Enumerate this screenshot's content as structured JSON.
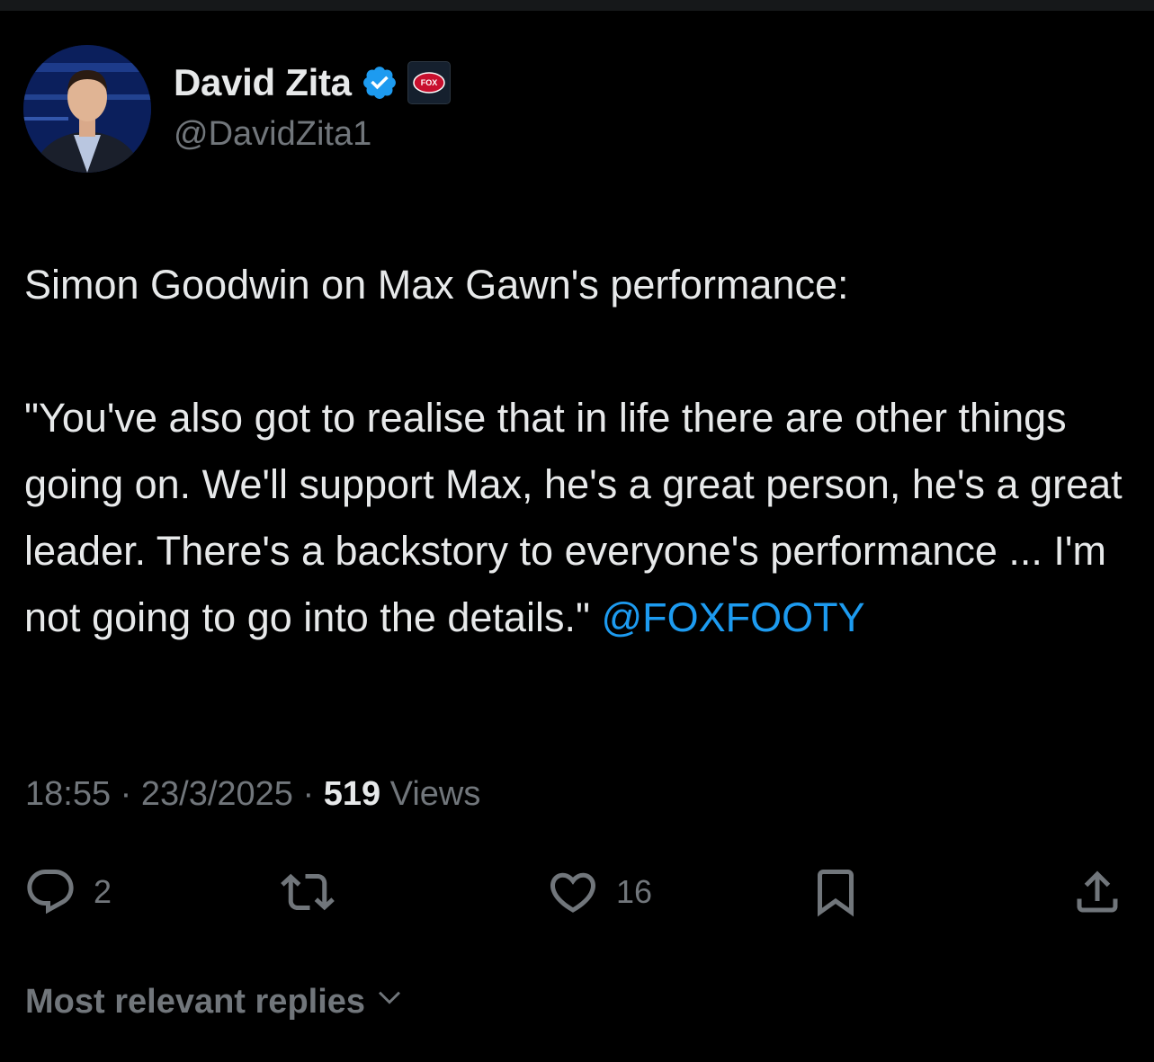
{
  "author": {
    "display_name": "David Zita",
    "handle": "@DavidZita1",
    "affiliate_badge_text": "FOX"
  },
  "tweet": {
    "text": "Simon Goodwin on Max Gawn's performance:\n\n\"You've also got to realise that in life there are other things going on. We'll support Max, he's a great person, he's a great leader. There's a backstory to everyone's performance ... I'm not going to go into the details.\" ",
    "mention": "@FOXFOOTY"
  },
  "meta": {
    "time": "18:55",
    "separator": " · ",
    "date": "23/3/2025",
    "views_count": "519",
    "views_label": " Views"
  },
  "actions": {
    "reply_icon": "reply-icon",
    "reply_count": "2",
    "repost_icon": "repost-icon",
    "like_icon": "heart-icon",
    "like_count": "16",
    "bookmark_icon": "bookmark-icon",
    "share_icon": "share-icon"
  },
  "replies": {
    "sort_label": "Most relevant replies"
  },
  "colors": {
    "background": "#000000",
    "text": "#e7e9ea",
    "muted": "#71767b",
    "accent": "#1d9bf0"
  }
}
